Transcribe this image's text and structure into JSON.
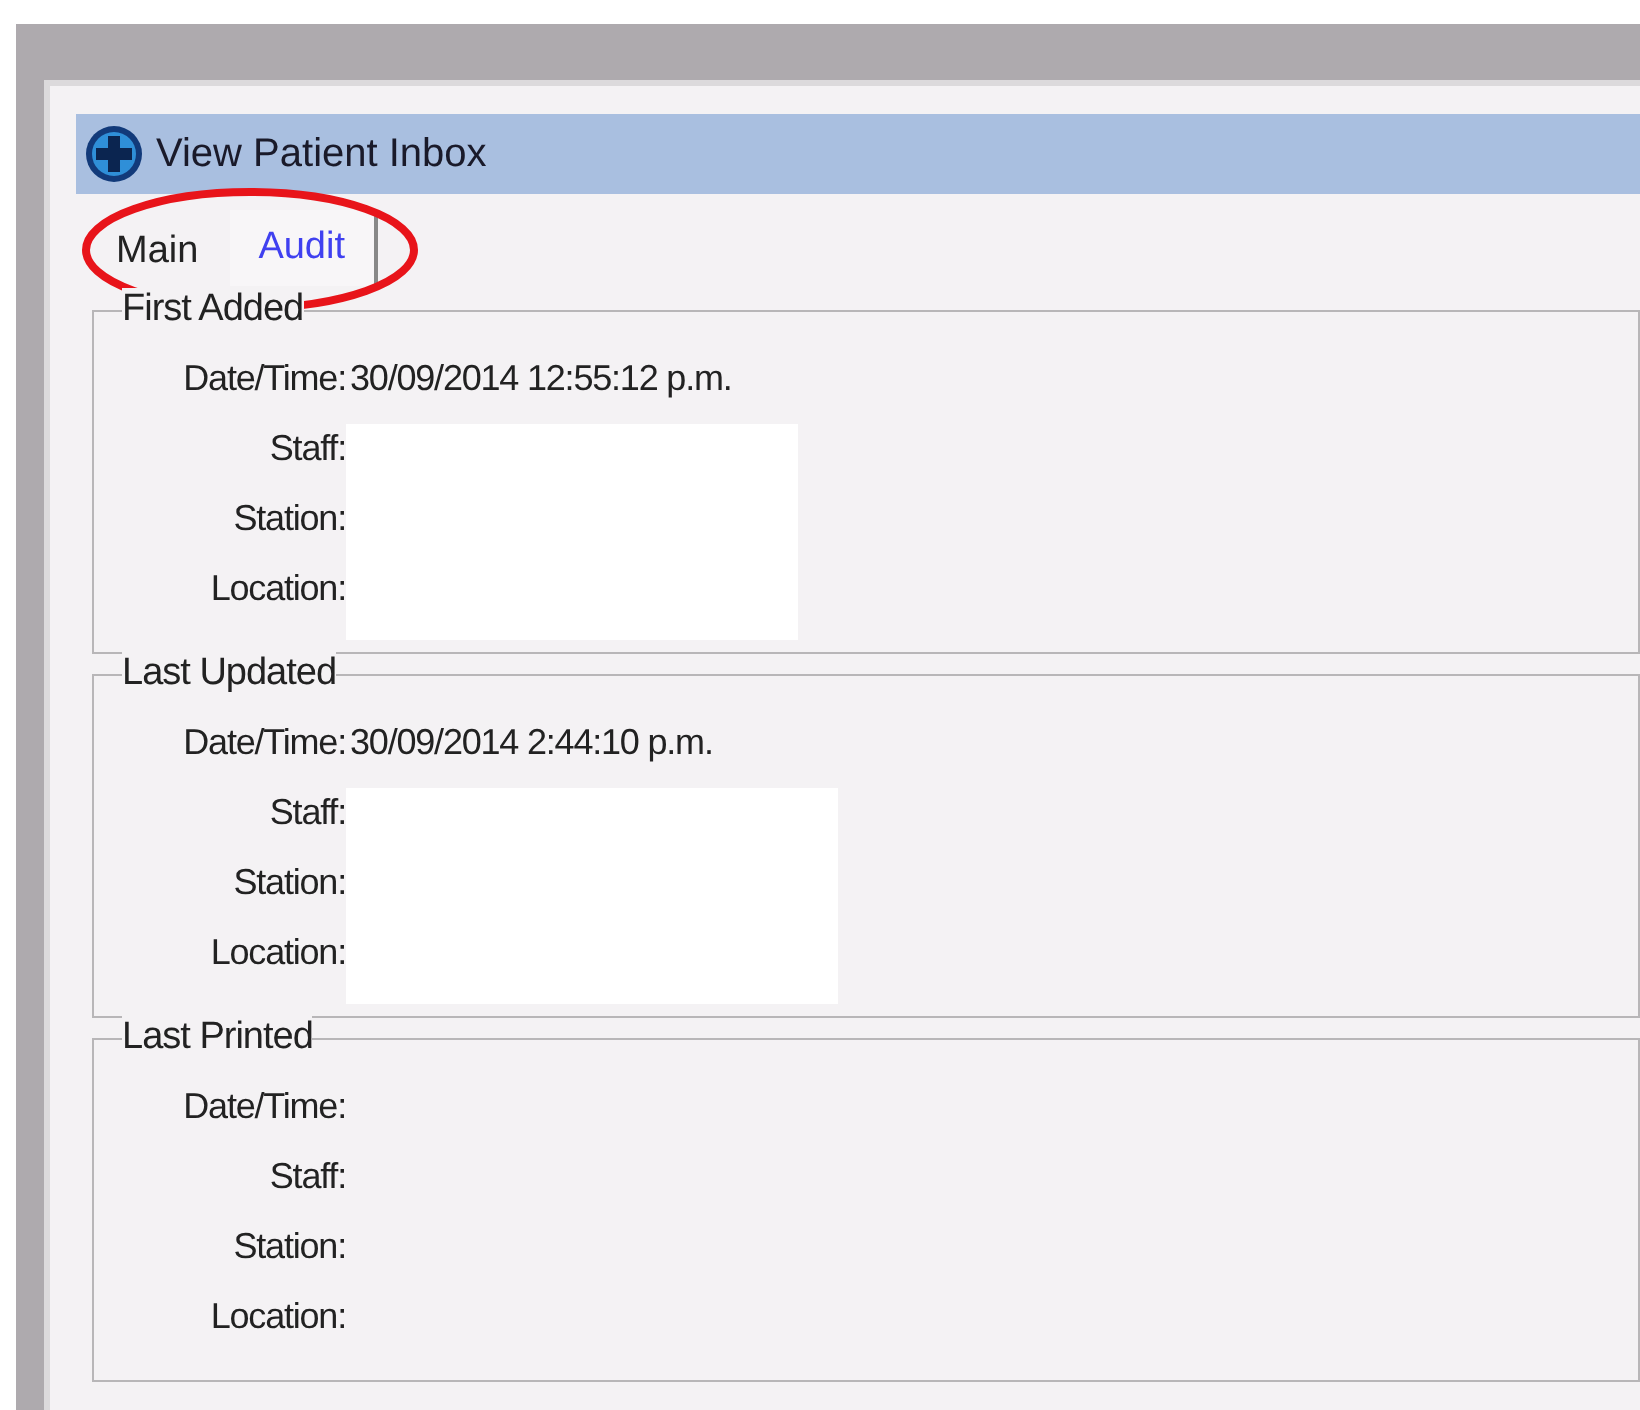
{
  "window": {
    "title": "View Patient Inbox"
  },
  "tabs": [
    {
      "label": "Main",
      "selected": false
    },
    {
      "label": "Audit",
      "selected": true
    }
  ],
  "tabs_circled": true,
  "groups": [
    {
      "title": "First Added",
      "redacted": true,
      "fields": [
        {
          "label": "Date/Time:",
          "value": "30/09/2014 12:55:12 p.m."
        },
        {
          "label": "Staff:"
        },
        {
          "label": "Station:"
        },
        {
          "label": "Location:"
        }
      ]
    },
    {
      "title": "Last Updated",
      "redacted": true,
      "fields": [
        {
          "label": "Date/Time:",
          "value": "30/09/2014 2:44:10 p.m."
        },
        {
          "label": "Staff:"
        },
        {
          "label": "Station:"
        },
        {
          "label": "Location:"
        }
      ]
    },
    {
      "title": "Last Printed",
      "redacted": false,
      "fields": [
        {
          "label": "Date/Time:"
        },
        {
          "label": "Staff:"
        },
        {
          "label": "Station:"
        },
        {
          "label": "Location:"
        }
      ]
    }
  ]
}
